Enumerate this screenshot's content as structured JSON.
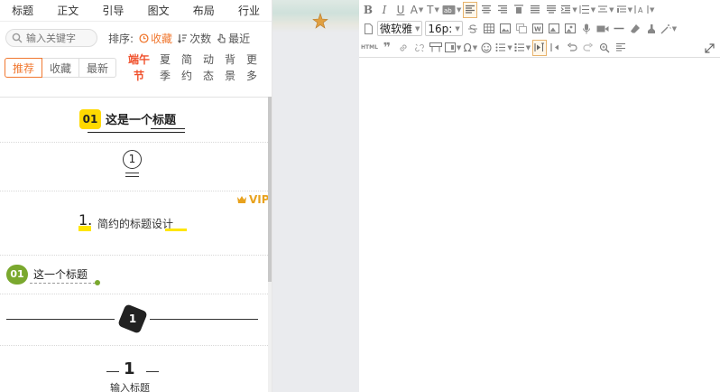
{
  "category_tabs": [
    "标题",
    "正文",
    "引导",
    "图文",
    "布局",
    "行业"
  ],
  "search": {
    "placeholder": "输入关键字"
  },
  "sort": {
    "label": "排序:",
    "options": [
      {
        "label": "收藏",
        "active": true
      },
      {
        "label": "次数",
        "active": false
      },
      {
        "label": "最近",
        "active": false
      }
    ]
  },
  "filter_tabs": [
    {
      "label": "推荐",
      "active": true
    },
    {
      "label": "收藏",
      "active": false
    },
    {
      "label": "最新",
      "active": false
    }
  ],
  "festival_label": "端午节",
  "vertical_tabs": [
    "夏季",
    "简约",
    "动态",
    "背景",
    "更多"
  ],
  "items": {
    "item1": {
      "badge": "01",
      "text": "这是一个标题"
    },
    "item2": {
      "num": "1"
    },
    "item3": {
      "vip": "VIP",
      "num": "1.",
      "text": "简约的标题设计"
    },
    "item4": {
      "badge": "01",
      "text": "这一个标题"
    },
    "item5": {
      "num": "1"
    },
    "item6": {
      "num": "1",
      "text": "输入标题"
    }
  },
  "editor": {
    "font_family": "微软雅",
    "font_size": "16p:",
    "html_label": "HTML"
  },
  "colors": {
    "accent": "#f07830",
    "festival": "#f0522e",
    "yellow": "#ffd900",
    "green": "#7aa82e",
    "vip": "#e8a21e"
  }
}
